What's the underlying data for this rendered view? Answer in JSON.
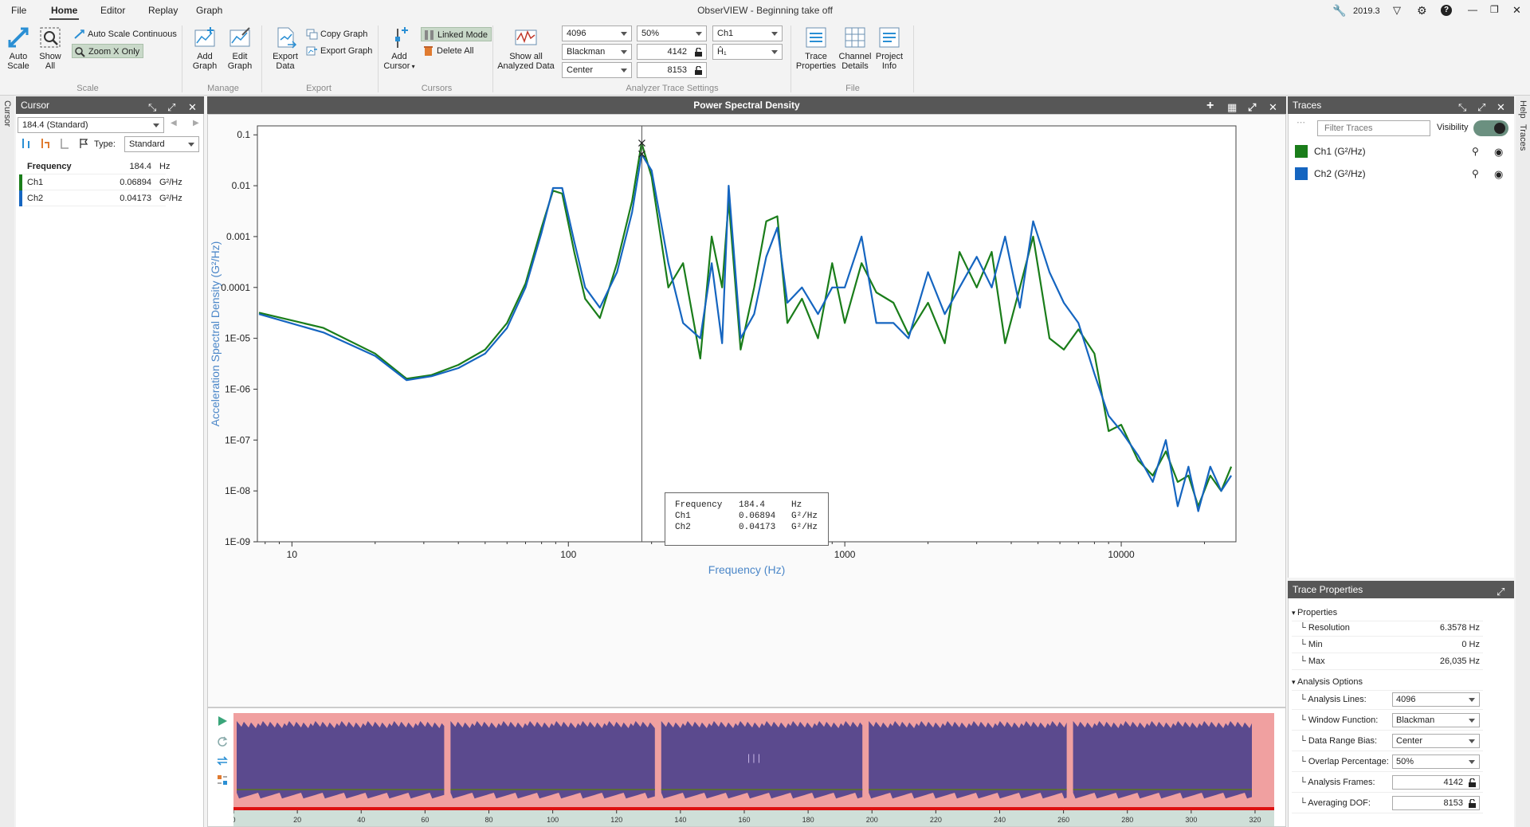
{
  "menu": {
    "tabs": [
      "File",
      "Home",
      "Editor",
      "Replay",
      "Graph"
    ],
    "active": "Home",
    "title": "ObserVIEW - Beginning take off",
    "version": "2019.3"
  },
  "ribbon": {
    "scale": {
      "auto_scale": "Auto Scale",
      "show_all": "Show All",
      "auto_scale_continuous": "Auto Scale Continuous",
      "zoom_x_only": "Zoom X Only",
      "label": "Scale"
    },
    "manage": {
      "add_graph": "Add Graph",
      "edit_graph": "Edit Graph",
      "label": "Manage"
    },
    "export": {
      "export_data": "Export Data",
      "copy_graph": "Copy Graph",
      "export_graph": "Export Graph",
      "label": "Export"
    },
    "cursors": {
      "add_cursor": "Add Cursor",
      "linked_mode": "Linked Mode",
      "delete_all": "Delete All",
      "label": "Cursors"
    },
    "analyzer": {
      "show_all_analyzed": "Show all Analyzed Data",
      "lines": "4096",
      "window": "Blackman",
      "bias": "Center",
      "overlap": "50%",
      "frames": "4142",
      "dof": "8153",
      "channel": "Ch1",
      "h1": "Ĥ₁",
      "label": "Analyzer Trace Settings"
    },
    "file": {
      "trace_properties": "Trace Properties",
      "channel_details": "Channel Details",
      "project_info": "Project Info",
      "label": "File"
    }
  },
  "sidebars": {
    "left": "Cursor",
    "right_help": "Help",
    "right_traces": "Traces"
  },
  "cursor_panel": {
    "title": "Cursor",
    "selected": "184.4 (Standard)",
    "type_label": "Type:",
    "type_value": "Standard",
    "rows": [
      {
        "name": "Frequency",
        "value": "184.4",
        "unit": "Hz",
        "color": ""
      },
      {
        "name": "Ch1",
        "value": "0.06894",
        "unit": "G²/Hz",
        "color": "#1a7d1a"
      },
      {
        "name": "Ch2",
        "value": "0.04173",
        "unit": "G²/Hz",
        "color": "#1565c0"
      }
    ]
  },
  "graph": {
    "title": "Power Spectral Density",
    "tooltip": [
      {
        "name": "Frequency",
        "value": "184.4",
        "unit": "Hz"
      },
      {
        "name": "Ch1",
        "value": "0.06894",
        "unit": "G²/Hz"
      },
      {
        "name": "Ch2",
        "value": "0.04173",
        "unit": "G²/Hz"
      }
    ]
  },
  "chart_data": {
    "type": "line",
    "title": "",
    "xlabel": "Frequency (Hz)",
    "ylabel": "Acceleration Spectral Density (G²/Hz)",
    "x_scale": "log",
    "y_scale": "log",
    "xlim": [
      7.5,
      26000
    ],
    "ylim": [
      1e-09,
      0.15
    ],
    "x_ticks": [
      {
        "v": 10,
        "l": "10"
      },
      {
        "v": 100,
        "l": "100"
      },
      {
        "v": 1000,
        "l": "1000"
      },
      {
        "v": 10000,
        "l": "10000"
      }
    ],
    "y_ticks": [
      {
        "v": 0.1,
        "l": "0.1"
      },
      {
        "v": 0.01,
        "l": "0.01"
      },
      {
        "v": 0.001,
        "l": "0.001"
      },
      {
        "v": 0.0001,
        "l": "0.0001"
      },
      {
        "v": 1e-05,
        "l": "1E-05"
      },
      {
        "v": 1e-06,
        "l": "1E-06"
      },
      {
        "v": 1e-07,
        "l": "1E-07"
      },
      {
        "v": 1e-08,
        "l": "1E-08"
      },
      {
        "v": 1e-09,
        "l": "1E-09"
      }
    ],
    "cursor_x": 184.4,
    "series": [
      {
        "name": "Ch1 (G²/Hz)",
        "color": "#1a7d1a",
        "x": [
          7.6,
          13,
          20,
          26,
          32,
          40,
          50,
          60,
          70,
          80,
          88,
          95,
          105,
          115,
          130,
          150,
          170,
          184,
          200,
          230,
          260,
          300,
          330,
          360,
          380,
          420,
          470,
          520,
          570,
          620,
          700,
          800,
          900,
          1000,
          1150,
          1300,
          1500,
          1700,
          2000,
          2300,
          2600,
          3000,
          3400,
          3800,
          4300,
          4800,
          5500,
          6200,
          7000,
          8000,
          9000,
          10000,
          11500,
          13000,
          14500,
          16000,
          17500,
          19000,
          21000,
          23000,
          25000
        ],
        "y": [
          3.2e-05,
          1.6e-05,
          5e-06,
          1.6e-06,
          1.9e-06,
          3e-06,
          6e-06,
          2e-05,
          0.00012,
          0.0015,
          0.008,
          0.007,
          0.0005,
          6e-05,
          2.5e-05,
          0.0003,
          0.005,
          0.069,
          0.015,
          0.0001,
          0.0003,
          4e-06,
          0.001,
          0.0001,
          0.005,
          6e-06,
          0.0001,
          0.002,
          0.0025,
          2e-05,
          6e-05,
          1e-05,
          0.0003,
          2e-05,
          0.0003,
          8e-05,
          5e-05,
          1.2e-05,
          5e-05,
          8e-06,
          0.0005,
          0.0001,
          0.0005,
          8e-06,
          0.0001,
          0.001,
          1e-05,
          6e-06,
          1.5e-05,
          5e-06,
          1.5e-07,
          2e-07,
          4e-08,
          2e-08,
          6e-08,
          1.5e-08,
          2e-08,
          5e-09,
          2e-08,
          1e-08,
          3e-08
        ]
      },
      {
        "name": "Ch2 (G²/Hz)",
        "color": "#1565c0",
        "x": [
          7.6,
          13,
          20,
          26,
          32,
          40,
          50,
          60,
          70,
          80,
          88,
          95,
          105,
          115,
          130,
          150,
          170,
          184,
          200,
          230,
          260,
          300,
          330,
          360,
          380,
          420,
          470,
          520,
          570,
          620,
          700,
          800,
          900,
          1000,
          1150,
          1300,
          1500,
          1700,
          2000,
          2300,
          2600,
          3000,
          3400,
          3800,
          4300,
          4800,
          5500,
          6200,
          7000,
          8000,
          9000,
          10000,
          11500,
          13000,
          14500,
          16000,
          17500,
          19000,
          21000,
          23000,
          25000
        ],
        "y": [
          3e-05,
          1.3e-05,
          4.5e-06,
          1.5e-06,
          1.8e-06,
          2.6e-06,
          5e-06,
          1.6e-05,
          0.0001,
          0.0012,
          0.009,
          0.009,
          0.0008,
          0.0001,
          4e-05,
          0.0002,
          0.003,
          0.042,
          0.02,
          0.0003,
          2e-05,
          1e-05,
          0.0003,
          8e-06,
          0.01,
          1e-05,
          3e-05,
          0.0004,
          0.0015,
          5e-05,
          0.0001,
          3e-05,
          0.0001,
          0.0001,
          0.001,
          2e-05,
          2e-05,
          1e-05,
          0.0002,
          3e-05,
          0.0001,
          0.0004,
          0.0001,
          0.001,
          4e-05,
          0.002,
          0.0002,
          5e-05,
          2e-05,
          2e-06,
          3e-07,
          1.5e-07,
          5e-08,
          1.5e-08,
          1e-07,
          5e-09,
          3e-08,
          4e-09,
          3e-08,
          1e-08,
          2e-08
        ]
      }
    ]
  },
  "timeline": {
    "ticks": [
      "0",
      "20",
      "40",
      "60",
      "80",
      "100",
      "120",
      "140",
      "160",
      "180",
      "200",
      "220",
      "240",
      "260",
      "280",
      "300",
      "320"
    ],
    "segments": [
      0,
      67,
      133,
      198,
      262,
      320
    ],
    "xmax": 326,
    "center_mark": "| | |"
  },
  "traces_panel": {
    "title": "Traces",
    "filter_placeholder": "Filter Traces",
    "visibility_label": "Visibility",
    "items": [
      {
        "label": "Ch1 (G²/Hz)",
        "color": "#1a7d1a"
      },
      {
        "label": "Ch2 (G²/Hz)",
        "color": "#1565c0"
      }
    ]
  },
  "properties_panel": {
    "title": "Trace Properties",
    "section_properties": "Properties",
    "resolution_label": "Resolution",
    "resolution": "6.3578 Hz",
    "min_label": "Min",
    "min": "0 Hz",
    "max_label": "Max",
    "max": "26,035 Hz",
    "section_analysis": "Analysis Options",
    "lines_label": "Analysis Lines:",
    "lines": "4096",
    "window_label": "Window Function:",
    "window": "Blackman",
    "bias_label": "Data Range Bias:",
    "bias": "Center",
    "overlap_label": "Overlap Percentage:",
    "overlap": "50%",
    "frames_label": "Analysis Frames:",
    "frames": "4142",
    "dof_label": "Averaging DOF:",
    "dof": "8153"
  }
}
